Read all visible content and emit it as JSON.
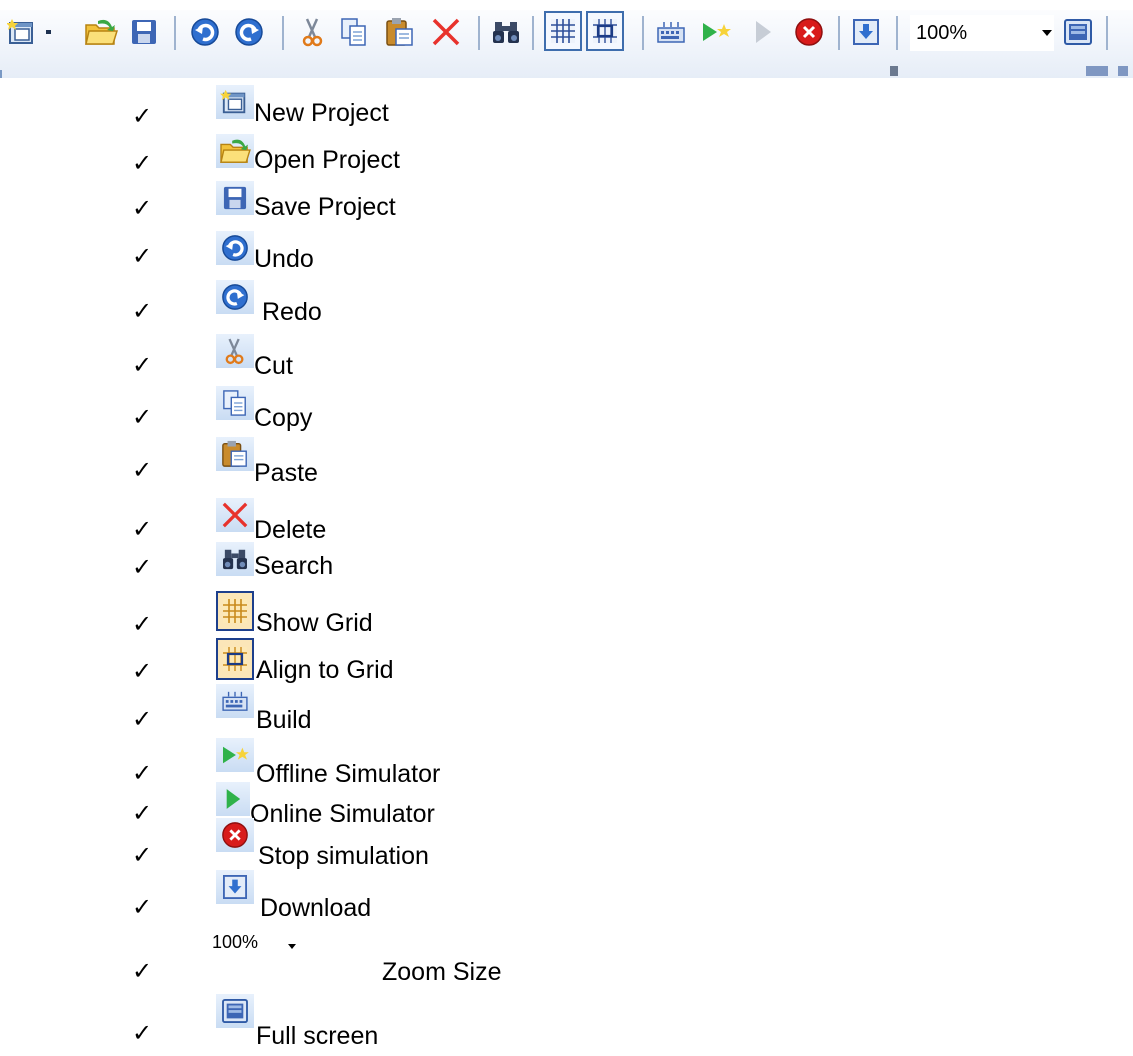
{
  "toolbar": {
    "zoom_value": "100%",
    "buttons": [
      "new-project",
      "open-project",
      "save-project",
      "undo",
      "redo",
      "cut",
      "copy",
      "paste",
      "delete",
      "search",
      "show-grid",
      "align-to-grid",
      "build",
      "offline-simulator",
      "online-simulator",
      "stop-simulation",
      "download",
      "zoom-size",
      "full-screen"
    ]
  },
  "legend": {
    "check_mark": "✓",
    "items": [
      {
        "label": "New Project",
        "icon": "new-project-icon"
      },
      {
        "label": "Open Project",
        "icon": "open-folder-icon"
      },
      {
        "label": "Save Project",
        "icon": "floppy-disk-icon"
      },
      {
        "label": "Undo",
        "icon": "undo-icon"
      },
      {
        "label": "Redo",
        "icon": "redo-icon"
      },
      {
        "label": "Cut",
        "icon": "scissors-icon"
      },
      {
        "label": "Copy",
        "icon": "copy-icon"
      },
      {
        "label": "Paste",
        "icon": "paste-icon"
      },
      {
        "label": "Delete",
        "icon": "delete-x-icon"
      },
      {
        "label": "Search",
        "icon": "binoculars-icon"
      },
      {
        "label": "Show Grid",
        "icon": "grid-icon"
      },
      {
        "label": "Align to Grid",
        "icon": "align-grid-icon"
      },
      {
        "label": "Build",
        "icon": "build-icon"
      },
      {
        "label": "Offline Simulator",
        "icon": "offline-simulator-icon"
      },
      {
        "label": "Online Simulator",
        "icon": "play-icon"
      },
      {
        "label": "Stop simulation",
        "icon": "stop-icon"
      },
      {
        "label": "Download",
        "icon": "download-icon"
      },
      {
        "label": "Zoom Size",
        "icon": "zoom-dropdown",
        "value": "100%"
      },
      {
        "label": "Full screen",
        "icon": "full-screen-icon"
      }
    ]
  },
  "colors": {
    "toolbar_separator": "#9fb3cf",
    "toggle_border": "#3e6dad",
    "icon_blue": "#2f6fcf",
    "delete_red": "#e8322c",
    "stop_red": "#d81b1b",
    "play_green": "#2fb24a",
    "folder_yellow": "#f2c23b"
  }
}
